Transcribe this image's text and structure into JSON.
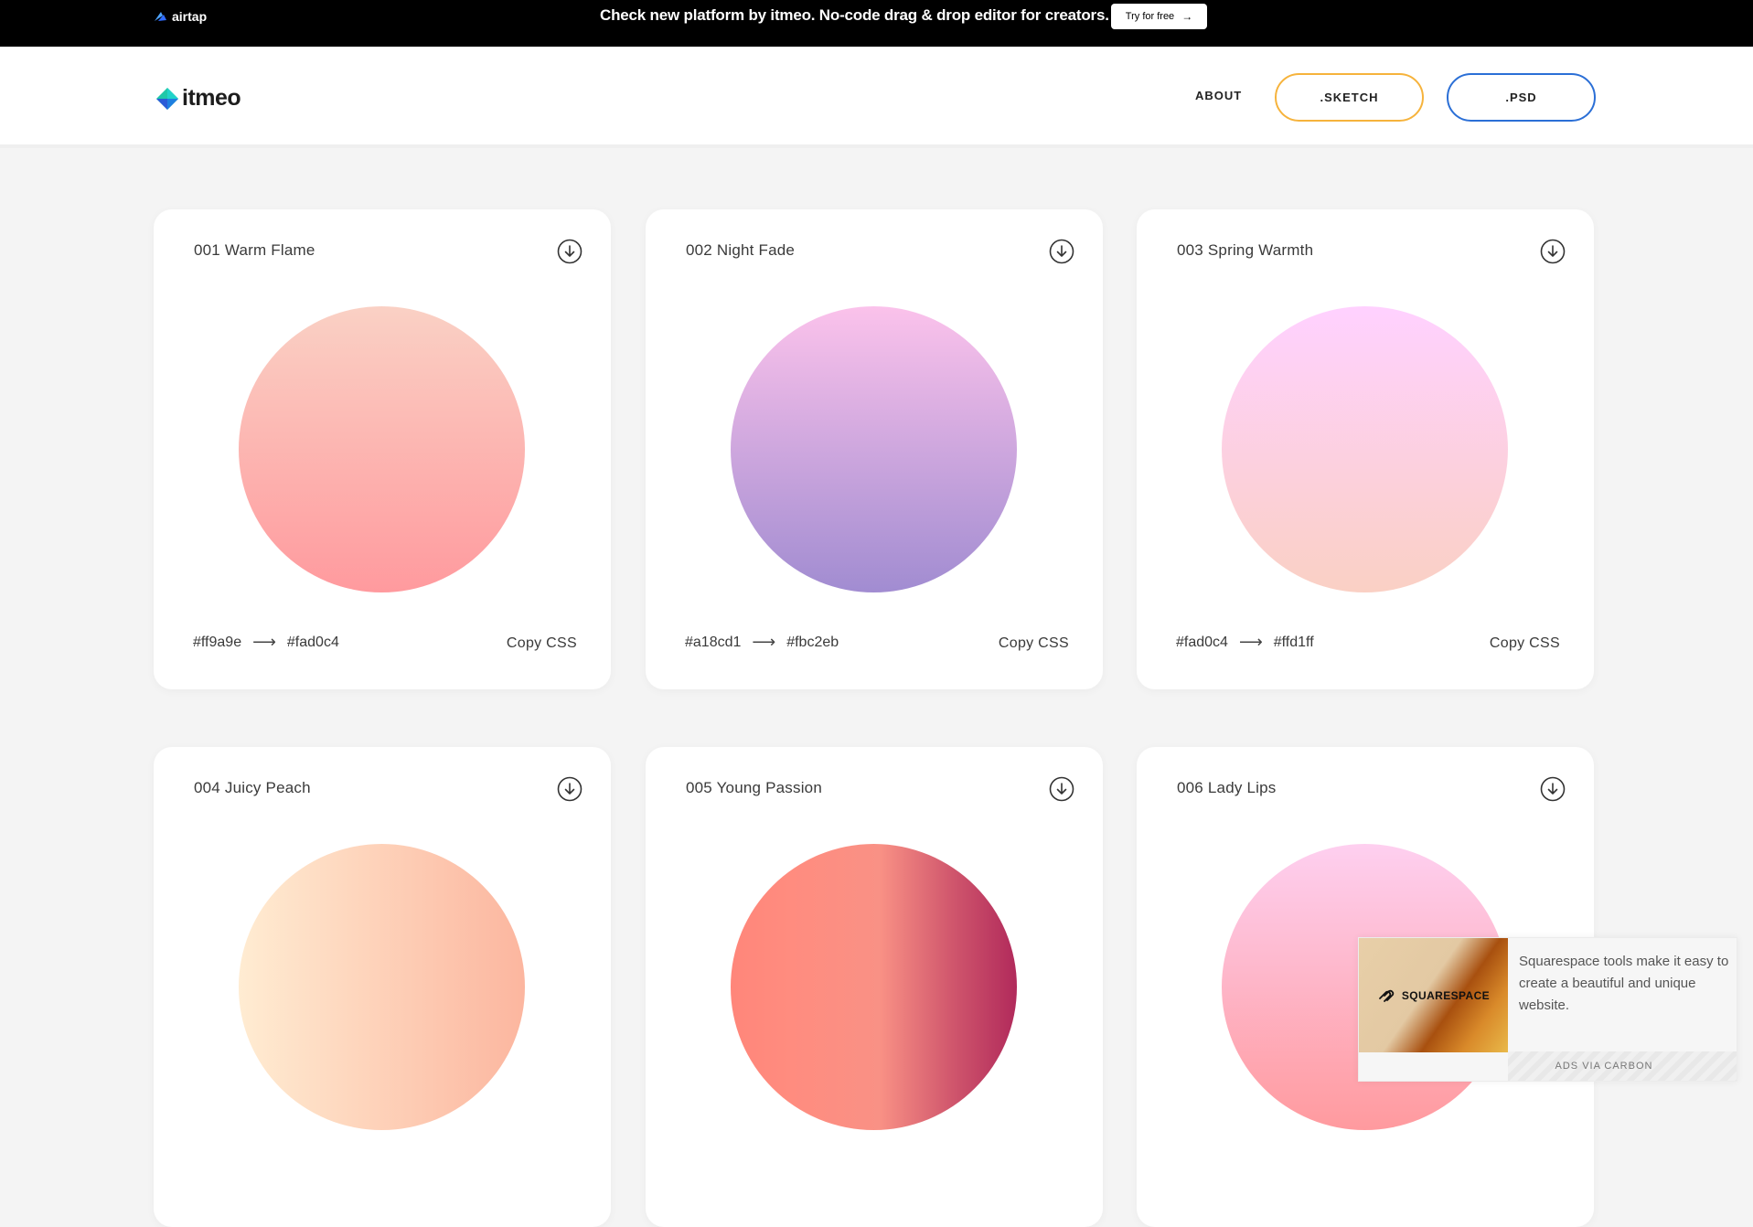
{
  "promo": {
    "brand": "airtap",
    "message": "Check new platform by itmeo. No-code drag & drop editor for creators.",
    "button_label": "Try for free",
    "button_arrow": "→"
  },
  "header": {
    "logo_text": "itmeo",
    "nav_about": "ABOUT",
    "nav_sketch": ".SKETCH",
    "nav_psd": ".PSD"
  },
  "cards": [
    {
      "title": "001 Warm Flame",
      "from": "#ff9a9e",
      "to": "#fad0c4",
      "copy": "Copy CSS"
    },
    {
      "title": "002 Night Fade",
      "from": "#a18cd1",
      "to": "#fbc2eb",
      "copy": "Copy CSS"
    },
    {
      "title": "003 Spring Warmth",
      "from": "#fad0c4",
      "to": "#ffd1ff",
      "copy": "Copy CSS"
    },
    {
      "title": "004 Juicy Peach",
      "from": "",
      "to": "",
      "copy": ""
    },
    {
      "title": "005 Young Passion",
      "from": "",
      "to": "",
      "copy": ""
    },
    {
      "title": "006 Lady Lips",
      "from": "",
      "to": "",
      "copy": ""
    }
  ],
  "arrow_glyph": "⟶",
  "colors": {
    "sketch_border": "#f6b33c",
    "psd_border": "#2b6fd6",
    "page_bg": "#f4f4f4"
  },
  "ad": {
    "brand": "SQUARESPACE",
    "text": "Squarespace tools make it easy to create a beautiful and unique website.",
    "via": "ADS VIA CARBON"
  }
}
